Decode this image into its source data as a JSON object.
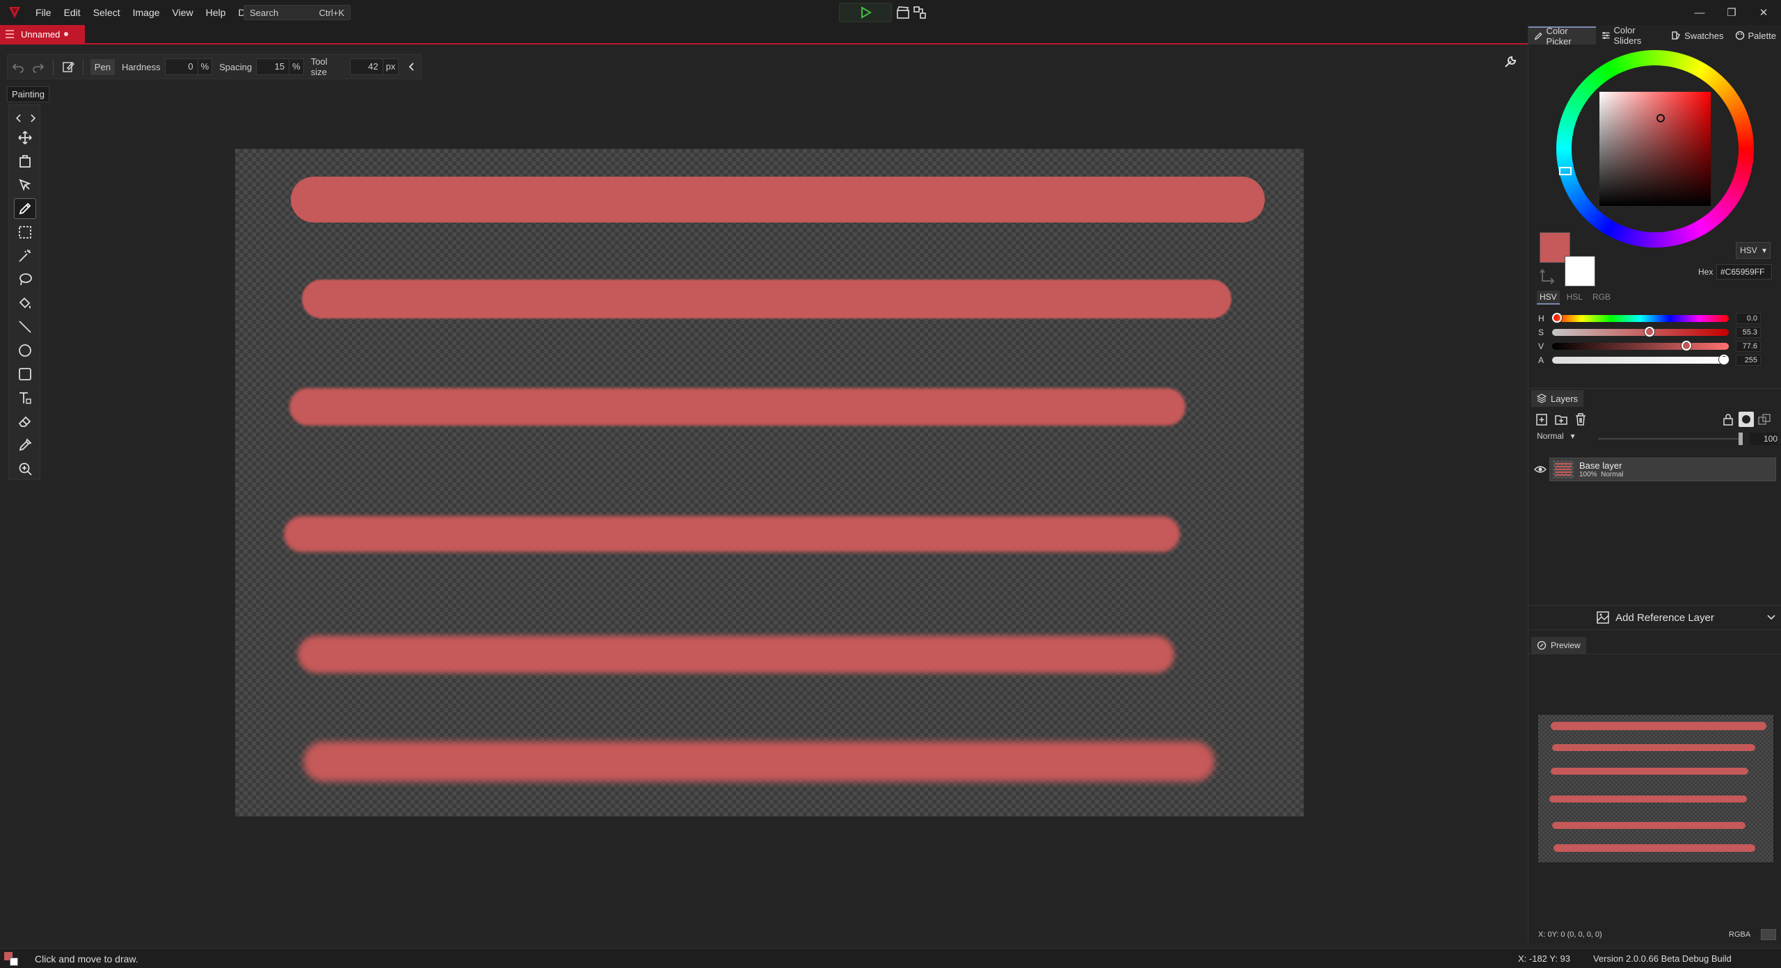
{
  "menubar": {
    "items": [
      "File",
      "Edit",
      "Select",
      "Image",
      "View",
      "Help",
      "Debug"
    ],
    "search_label": "Search",
    "search_shortcut": "Ctrl+K"
  },
  "document": {
    "tab_title": "Unnamed"
  },
  "tool_options": {
    "tool_name": "Pen",
    "hardness_label": "Hardness",
    "hardness_value": "0",
    "hardness_unit": "%",
    "spacing_label": "Spacing",
    "spacing_value": "15",
    "spacing_unit": "%",
    "size_label": "Tool size",
    "size_value": "42",
    "size_unit": "px",
    "tooltip": "Painting"
  },
  "toolbox": {
    "active_tool": "pen",
    "tools": [
      "move-icon",
      "crop-icon",
      "selection-pointer-icon",
      "pen-icon",
      "rect-select-icon",
      "magic-wand-icon",
      "lasso-icon",
      "paint-bucket-icon",
      "line-icon",
      "ellipse-icon",
      "rectangle-icon",
      "text-icon",
      "eraser-icon",
      "eyedropper-icon",
      "zoom-icon"
    ]
  },
  "stroke_color": "#c65959",
  "color_panel": {
    "tabs": [
      "Color Picker",
      "Color Sliders",
      "Swatches",
      "Palette"
    ],
    "active_tab": "Color Picker",
    "mode": "HSV",
    "hex_label": "Hex",
    "hex_value": "#C65959FF",
    "color_modes": [
      "HSV",
      "HSL",
      "RGB"
    ],
    "primary_color": "#c65959",
    "secondary_color": "#ffffff",
    "sliders": [
      {
        "channel": "H",
        "value": "0.0",
        "fraction": 0.0
      },
      {
        "channel": "S",
        "value": "55.3",
        "fraction": 0.553
      },
      {
        "channel": "V",
        "value": "77.6",
        "fraction": 0.776
      },
      {
        "channel": "A",
        "value": "255",
        "fraction": 1.0
      }
    ]
  },
  "layers": {
    "tab_label": "Layers",
    "blend_mode": "Normal",
    "opacity": "100",
    "items": [
      {
        "name": "Base layer",
        "opacity": "100%",
        "blend": "Normal"
      }
    ]
  },
  "reference": {
    "label": "Add Reference Layer"
  },
  "preview": {
    "tab_label": "Preview"
  },
  "readout": {
    "pixel": "X: 0Y: 0   (0, 0, 0, 0)",
    "channel": "RGBA"
  },
  "status": {
    "message": "Click and move to draw.",
    "coords": "X: -182 Y: 93",
    "version": "Version 2.0.0.66 Beta Debug Build"
  }
}
